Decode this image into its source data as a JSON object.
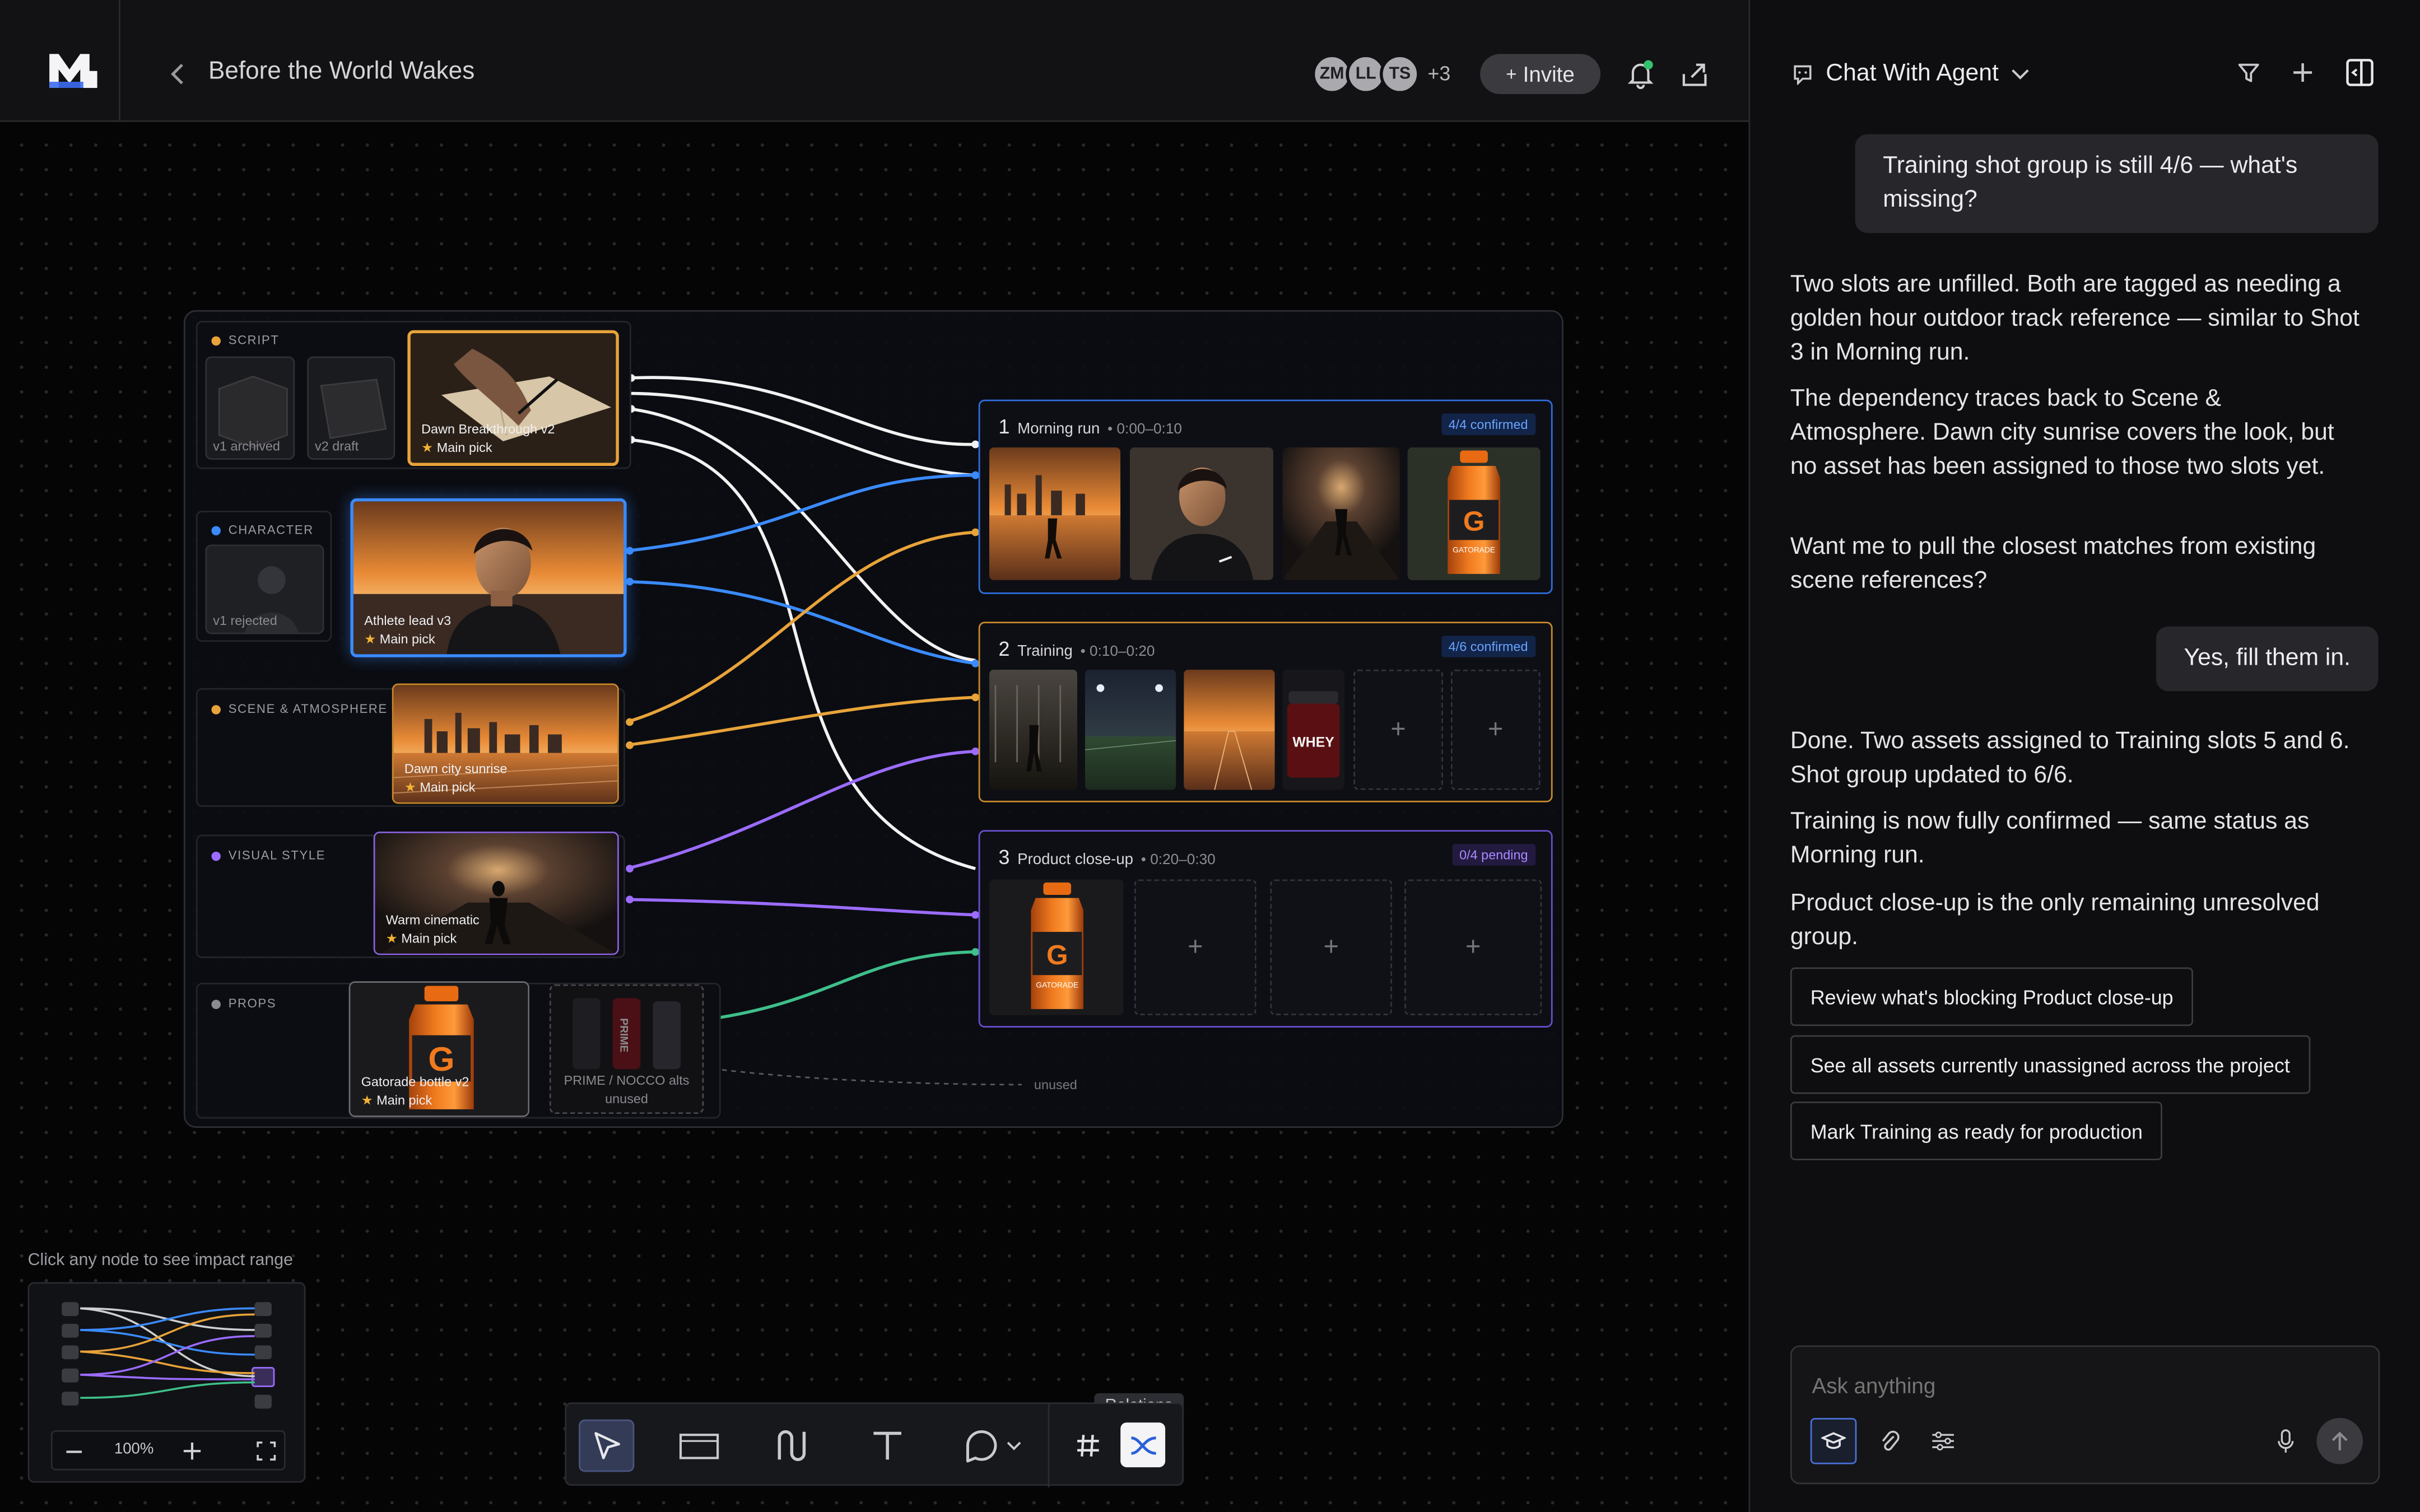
{
  "project": {
    "title": "Before the World Wakes"
  },
  "collaborators": {
    "avatars": [
      "ZM",
      "LL",
      "TS"
    ],
    "more": "+3",
    "invite_label": "Invite"
  },
  "board": {
    "sections": {
      "script": {
        "label": "SCRIPT",
        "versions": [
          "v1 archived",
          "v2 draft"
        ],
        "main": {
          "title": "Dawn Breakthrough v2",
          "tag": "Main pick"
        }
      },
      "character": {
        "label": "CHARACTER",
        "versions": [
          "v1 rejected"
        ],
        "main": {
          "title": "Athlete lead v3",
          "tag": "Main pick"
        }
      },
      "scene": {
        "label": "SCENE & ATMOSPHERE",
        "main": {
          "title": "Dawn city sunrise",
          "tag": "Main pick"
        }
      },
      "visual": {
        "label": "VISUAL STYLE",
        "main": {
          "title": "Warm cinematic",
          "tag": "Main pick"
        }
      },
      "props": {
        "label": "PROPS",
        "main": {
          "title": "Gatorade bottle v2",
          "tag": "Main pick"
        },
        "alt": {
          "title": "PRIME / NOCCO alts",
          "tag": "unused"
        },
        "alt_brands": [
          "PRIME"
        ],
        "unused_label": "unused"
      }
    },
    "groups": [
      {
        "num": "1",
        "name": "Morning run",
        "time": "0:00–0:10",
        "status": "4/4 confirmed",
        "product_label": "GATORADE"
      },
      {
        "num": "2",
        "name": "Training",
        "time": "0:10–0:20",
        "status": "4/6 confirmed",
        "product_label": "WHEY"
      },
      {
        "num": "3",
        "name": "Product close-up",
        "time": "0:20–0:30",
        "status": "0/4 pending",
        "product_label": "GATORADE"
      }
    ]
  },
  "canvas": {
    "hint": "Click any node to see impact range",
    "zoom": "100%",
    "relations_tooltip": "Relations"
  },
  "chat": {
    "title": "Chat With Agent",
    "messages": [
      {
        "role": "user",
        "text": "Training shot group is still 4/6 — what's missing?"
      },
      {
        "role": "agent",
        "text": "Two slots are unfilled. Both are tagged as needing a golden hour outdoor track reference — similar to Shot 3 in Morning run."
      },
      {
        "role": "agent",
        "text": "The dependency traces back to Scene & Atmosphere. Dawn city sunrise covers the look, but no asset has been assigned to those two slots yet."
      },
      {
        "role": "agent",
        "text": "Want me to pull the closest matches from existing scene references?"
      },
      {
        "role": "user",
        "text": "Yes, fill them in."
      },
      {
        "role": "agent",
        "text": "Done. Two assets assigned to Training slots 5 and 6. Shot group updated to 6/6."
      },
      {
        "role": "agent",
        "text": "Training is now fully confirmed — same status as Morning run."
      },
      {
        "role": "agent",
        "text": "Product close-up is the only remaining unresolved group."
      }
    ],
    "suggestions": [
      "Review what's blocking Product close-up",
      "See all assets currently unassigned across the project",
      "Mark Training as ready for production"
    ],
    "composer_placeholder": "Ask anything"
  },
  "colors": {
    "script": "#e8a33a",
    "character": "#3b8bff",
    "scene": "#e8a33a",
    "visual": "#9b6cff",
    "props": "#8a8a90",
    "edge_white": "#f2f2f2",
    "edge_green": "#3fbf8a",
    "group1_border": "#2e6fe0",
    "group2_border": "#c98a2a",
    "group3_border": "#6a4fd0"
  }
}
